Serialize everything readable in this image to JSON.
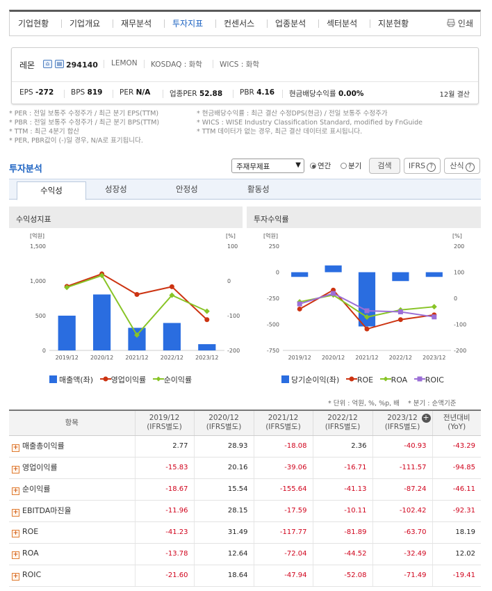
{
  "nav": {
    "items": [
      "기업현황",
      "기업개요",
      "재무분석",
      "투자지표",
      "컨센서스",
      "업종분석",
      "섹터분석",
      "지분현황"
    ],
    "active": "투자지표",
    "print_label": "인쇄"
  },
  "company": {
    "name": "레몬",
    "code": "294140",
    "english": "LEMON",
    "market": "KOSDAQ : 화학",
    "wics": "WICS : 화학",
    "fiscal": "12월 결산",
    "ratios": [
      {
        "label": "EPS",
        "value": "-272"
      },
      {
        "label": "BPS",
        "value": "819"
      },
      {
        "label": "PER",
        "value": "N/A"
      },
      {
        "label": "업종PER",
        "value": "52.88"
      },
      {
        "label": "PBR",
        "value": "4.16"
      },
      {
        "label": "현금배당수익률",
        "value": "0.00%"
      }
    ]
  },
  "notes": {
    "left": [
      "* PER : 전일 보통주 수정주가 / 최근 분기 EPS(TTM)",
      "* PBR : 전일 보통주 수정주가 / 최근 분기 BPS(TTM)",
      "* TTM : 최근 4분기 합산",
      "* PER, PBR값이 (-)일 경우, N/A로 표기됩니다."
    ],
    "right": [
      "* 현금배당수익률 : 최근 결산 수정DPS(현금) / 전일 보통주 수정주가",
      "* WICS : WISE Industry Classification Standard, modified by FnGuide",
      "* TTM 데이터가 없는 경우, 최근 결산 데이터로 표시됩니다."
    ]
  },
  "analysis": {
    "title": "투자분석",
    "select_value": "주재무제표",
    "radio_annual": "연간",
    "radio_quarter": "분기",
    "search_label": "검색",
    "ifrs_label": "IFRS",
    "calc_label": "산식"
  },
  "tabs": [
    "수익성",
    "성장성",
    "안정성",
    "활동성"
  ],
  "charts": {
    "left_title": "수익성지표",
    "right_title": "투자수익률",
    "unit_left": "[억원]",
    "unit_right": "[%]",
    "left_legend": [
      "매출액(좌)",
      "영업이익률",
      "순이익률"
    ],
    "right_legend": [
      "당기순이익(좌)",
      "ROE",
      "ROA",
      "ROIC"
    ],
    "colors": {
      "bar": "#2a6de0",
      "red": "#cc3311",
      "green": "#88c426",
      "purple": "#9b6fd6"
    }
  },
  "chart_data": [
    {
      "type": "bar",
      "title": "수익성지표",
      "categories": [
        "2019/12",
        "2020/12",
        "2021/12",
        "2022/12",
        "2023/12"
      ],
      "y_left": {
        "label": "[억원]",
        "range": [
          0,
          1500
        ],
        "ticks": [
          "1,500",
          "1,000",
          "500",
          "0"
        ]
      },
      "y_right": {
        "label": "[%]",
        "range": [
          -200,
          100
        ],
        "ticks": [
          "100",
          "0",
          "-100",
          "-200"
        ]
      },
      "series": [
        {
          "name": "매출액(좌)",
          "type": "bar",
          "axis": "left",
          "values": [
            500,
            805,
            325,
            395,
            90
          ]
        },
        {
          "name": "영업이익률",
          "type": "line",
          "axis": "right",
          "values": [
            -15.83,
            20.16,
            -39.06,
            -16.71,
            -111.57
          ]
        },
        {
          "name": "순이익률",
          "type": "line",
          "axis": "right",
          "values": [
            -18.67,
            15.54,
            -155.64,
            -41.13,
            -87.24
          ]
        }
      ]
    },
    {
      "type": "bar",
      "title": "투자수익률",
      "categories": [
        "2019/12",
        "2020/12",
        "2021/12",
        "2022/12",
        "2023/12"
      ],
      "y_left": {
        "label": "[억원]",
        "range": [
          -750,
          250
        ],
        "ticks": [
          "250",
          "0",
          "-250",
          "-500",
          "-750"
        ]
      },
      "y_right": {
        "label": "[%]",
        "range": [
          -200,
          200
        ],
        "ticks": [
          "200",
          "100",
          "0",
          "-100",
          "-200"
        ]
      },
      "series": [
        {
          "name": "당기순이익(좌)",
          "type": "bar",
          "axis": "left",
          "values": [
            -45,
            65,
            -520,
            -85,
            -45
          ]
        },
        {
          "name": "ROE",
          "type": "line",
          "axis": "right",
          "values": [
            -41.23,
            31.49,
            -117.77,
            -81.89,
            -63.7
          ]
        },
        {
          "name": "ROA",
          "type": "line",
          "axis": "right",
          "values": [
            -13.78,
            12.64,
            -72.04,
            -44.52,
            -32.49
          ]
        },
        {
          "name": "ROIC",
          "type": "line",
          "axis": "right",
          "values": [
            -21.6,
            18.64,
            -47.94,
            -52.08,
            -71.49
          ]
        }
      ]
    }
  ],
  "table": {
    "unit_note": "* 단위 : 억원, %, %p, 배",
    "quarter_note": "* 분기 : 순액기준",
    "header_item": "항목",
    "columns": [
      {
        "period": "2019/12",
        "basis": "(IFRS별도)"
      },
      {
        "period": "2020/12",
        "basis": "(IFRS별도)"
      },
      {
        "period": "2021/12",
        "basis": "(IFRS별도)"
      },
      {
        "period": "2022/12",
        "basis": "(IFRS별도)"
      },
      {
        "period": "2023/12",
        "basis": "(IFRS별도)"
      },
      {
        "period": "전년대비",
        "basis": "(YoY)"
      }
    ],
    "rows": [
      {
        "label": "매출총이익률",
        "values": [
          "2.77",
          "28.93",
          "-18.08",
          "2.36",
          "-40.93",
          "-43.29"
        ]
      },
      {
        "label": "영업이익률",
        "values": [
          "-15.83",
          "20.16",
          "-39.06",
          "-16.71",
          "-111.57",
          "-94.85"
        ]
      },
      {
        "label": "순이익률",
        "values": [
          "-18.67",
          "15.54",
          "-155.64",
          "-41.13",
          "-87.24",
          "-46.11"
        ]
      },
      {
        "label": "EBITDA마진율",
        "values": [
          "-11.96",
          "28.15",
          "-17.59",
          "-10.11",
          "-102.42",
          "-92.31"
        ]
      },
      {
        "label": "ROE",
        "values": [
          "-41.23",
          "31.49",
          "-117.77",
          "-81.89",
          "-63.70",
          "18.19"
        ]
      },
      {
        "label": "ROA",
        "values": [
          "-13.78",
          "12.64",
          "-72.04",
          "-44.52",
          "-32.49",
          "12.02"
        ]
      },
      {
        "label": "ROIC",
        "values": [
          "-21.60",
          "18.64",
          "-47.94",
          "-52.08",
          "-71.49",
          "-19.41"
        ]
      }
    ]
  }
}
